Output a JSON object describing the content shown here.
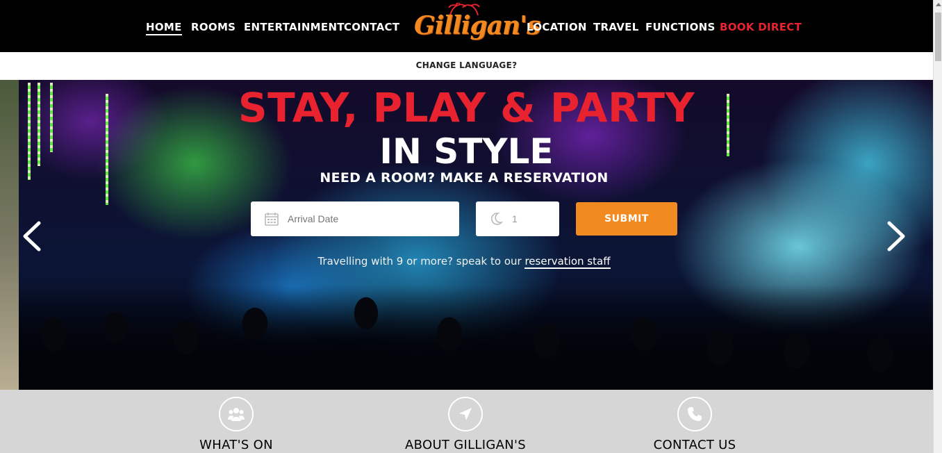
{
  "nav": {
    "left": [
      "HOME",
      "ROOMS",
      "ENTERTAINMENT",
      "CONTACT"
    ],
    "right": [
      "LOCATION",
      "TRAVEL",
      "FUNCTIONS"
    ],
    "book": "BOOK DIRECT",
    "brand": "Gilligan's"
  },
  "language": {
    "label": "CHANGE LANGUAGE?"
  },
  "hero": {
    "title_line1": "STAY, PLAY & PARTY",
    "title_line2": "IN STYLE",
    "subtitle": "NEED A ROOM? MAKE A RESERVATION",
    "arrival_placeholder": "Arrival Date",
    "nights_value": "1",
    "submit_label": "SUBMIT",
    "group_note": "Travelling with 9 or more? speak to our",
    "group_link": "reservation staff"
  },
  "features": [
    {
      "title": "WHAT'S ON",
      "icon": "users-icon"
    },
    {
      "title": "ABOUT GILLIGAN'S",
      "icon": "location-arrow-icon"
    },
    {
      "title": "CONTACT US",
      "icon": "phone-icon"
    }
  ],
  "colors": {
    "accent_orange": "#f28a22",
    "accent_red": "#e8232f",
    "nav_bg": "#000000",
    "feature_bg": "#d6d6d6"
  }
}
